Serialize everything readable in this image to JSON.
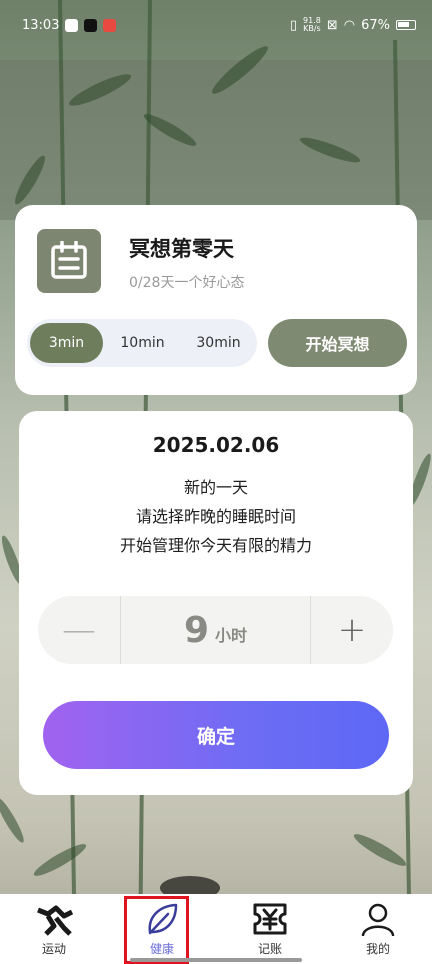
{
  "status_bar": {
    "time": "13:03",
    "net_speed": "91.8",
    "net_unit": "KB/s",
    "battery": "67%"
  },
  "meditation": {
    "title": "冥想第零天",
    "subtitle": "0/28天一个好心态",
    "durations": [
      "3min",
      "10min",
      "30min"
    ],
    "selected_duration": "3min",
    "start_label": "开始冥想",
    "icon": "calendar-icon"
  },
  "sleep": {
    "date": "2025.02.06",
    "lines": [
      "新的一天",
      "请选择昨晚的睡眠时间",
      "开始管理你今天有限的精力"
    ],
    "hours_value": "9",
    "hours_unit": "小时",
    "minus_label": "—",
    "plus_label": "+",
    "confirm_label": "确定"
  },
  "tabs": [
    {
      "label": "运动",
      "icon": "running-icon"
    },
    {
      "label": "健康",
      "icon": "leaf-icon"
    },
    {
      "label": "记账",
      "icon": "yuan-ticket-icon"
    },
    {
      "label": "我的",
      "icon": "person-icon"
    }
  ],
  "active_tab": "健康",
  "colors": {
    "accent_green": "#6e7d5c",
    "confirm_gradient_start": "#a163f0",
    "confirm_gradient_end": "#5d68f5",
    "tab_active": "#6b6eda",
    "highlight_box": "#e0141e"
  }
}
